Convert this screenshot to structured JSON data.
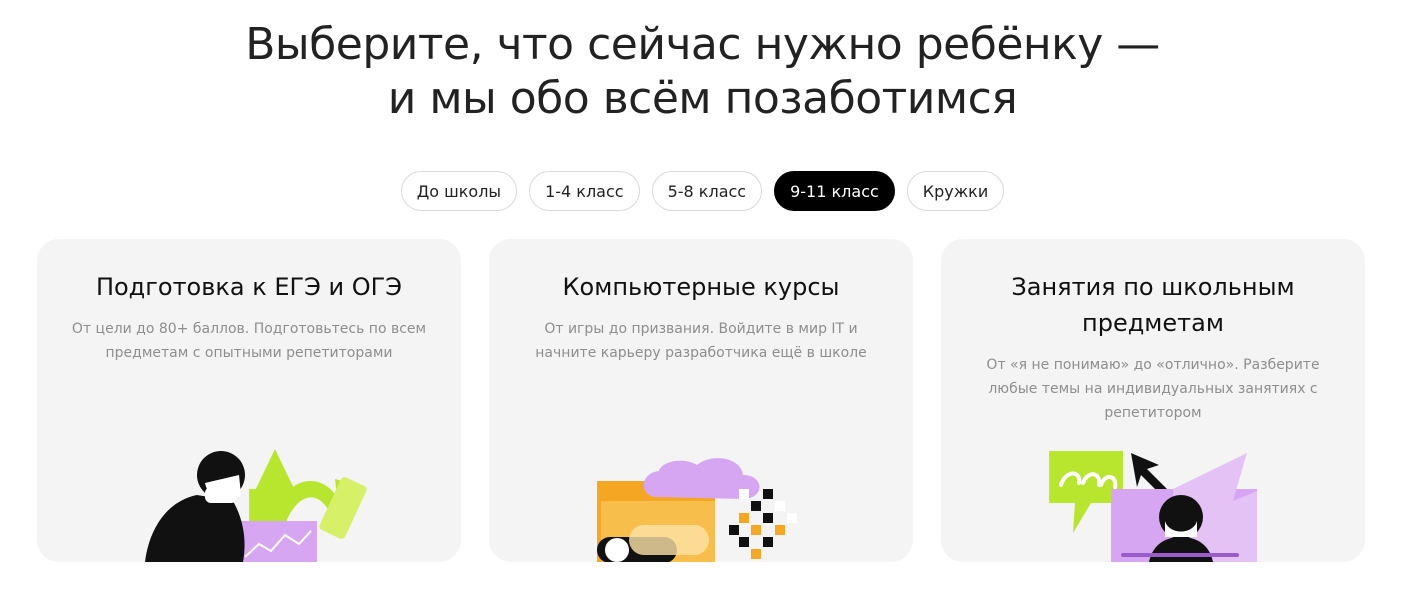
{
  "header": {
    "title_line1": "Выберите, что сейчас нужно ребёнку —",
    "title_line2": "и мы обо всём позаботимся"
  },
  "tabs": [
    {
      "label": "До школы",
      "active": false
    },
    {
      "label": "1-4 класс",
      "active": false
    },
    {
      "label": "5-8 класс",
      "active": false
    },
    {
      "label": "9-11 класс",
      "active": true
    },
    {
      "label": "Кружки",
      "active": false
    }
  ],
  "cards": [
    {
      "title": "Подготовка к ЕГЭ и ОГЭ",
      "description": "От цели до 80+ баллов. Подготовьтесь по всем предметам с опытными репетиторами",
      "illustration": "student-growth-arrow"
    },
    {
      "title": "Компьютерные курсы",
      "description": "От игры до призвания. Войдите в мир IT и начните карьеру разработчика ещё в школе",
      "illustration": "folder-cloud-pixels"
    },
    {
      "title": "Занятия по школьным предметам",
      "description": "От «я не понимаю» до «отлично». Разберите любые темы на индивидуальных занятиях с репетитором",
      "illustration": "online-lesson-screen"
    }
  ],
  "colors": {
    "accent_green": "#b8e62e",
    "accent_lilac": "#d6a6f2",
    "accent_orange": "#f5a623",
    "card_bg": "#f4f4f4",
    "active_tab_bg": "#000000"
  }
}
